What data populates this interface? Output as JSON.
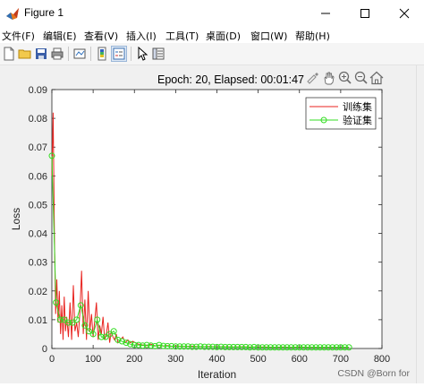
{
  "window": {
    "title": "Figure 1",
    "controls": [
      "minimize-icon",
      "maximize-icon",
      "close-icon"
    ]
  },
  "menu": {
    "items": [
      "文件(F)",
      "编辑(E)",
      "查看(V)",
      "插入(I)",
      "工具(T)",
      "桌面(D)",
      "窗口(W)",
      "帮助(H)"
    ]
  },
  "toolbar": {
    "icons": [
      "new-figure-icon",
      "open-file-icon",
      "save-icon",
      "print-icon",
      "link-plot-icon",
      "insert-colorbar-icon",
      "insert-legend-icon",
      "pointer-icon",
      "property-inspector-icon"
    ]
  },
  "axes_toolbar": {
    "icons": [
      "brush-icon",
      "pan-hand-icon",
      "zoom-in-icon",
      "zoom-out-icon",
      "home-icon"
    ]
  },
  "watermark": "CSDN @Born for",
  "chart_data": {
    "type": "line",
    "title": "Epoch: 20, Elapsed: 00:01:47",
    "xlabel": "Iteration",
    "ylabel": "Loss",
    "xlim": [
      0,
      800
    ],
    "ylim": [
      0,
      0.09
    ],
    "xticks": [
      "0",
      "100",
      "200",
      "300",
      "400",
      "500",
      "600",
      "700",
      "800"
    ],
    "yticks": [
      "0",
      "0.01",
      "0.02",
      "0.03",
      "0.04",
      "0.05",
      "0.06",
      "0.07",
      "0.08",
      "0.09"
    ],
    "legend_position": "top-right",
    "grid": false,
    "series": [
      {
        "name": "训练集",
        "color": "#e8231f",
        "marker": "none",
        "x": [
          0,
          3,
          6,
          9,
          12,
          15,
          18,
          21,
          24,
          27,
          30,
          33,
          36,
          40,
          44,
          48,
          52,
          56,
          60,
          64,
          68,
          72,
          76,
          80,
          84,
          88,
          92,
          96,
          100,
          104,
          108,
          112,
          116,
          120,
          124,
          128,
          132,
          136,
          140,
          144,
          148,
          152,
          156,
          160,
          166,
          172,
          178,
          184,
          190,
          196,
          202,
          210,
          220,
          230,
          240,
          250,
          260,
          270,
          280,
          290,
          300,
          320,
          340,
          360,
          380,
          400,
          420,
          440,
          460,
          480,
          500,
          520,
          540,
          560,
          580,
          600,
          620,
          640,
          660,
          680,
          700,
          720
        ],
        "y": [
          0.06,
          0.082,
          0.04,
          0.012,
          0.024,
          0.009,
          0.02,
          0.005,
          0.015,
          0.003,
          0.018,
          0.006,
          0.011,
          0.004,
          0.016,
          0.003,
          0.022,
          0.006,
          0.009,
          0.004,
          0.013,
          0.027,
          0.005,
          0.017,
          0.003,
          0.02,
          0.006,
          0.012,
          0.004,
          0.01,
          0.016,
          0.003,
          0.008,
          0.005,
          0.011,
          0.003,
          0.005,
          0.009,
          0.002,
          0.006,
          0.004,
          0.003,
          0.005,
          0.002,
          0.003,
          0.004,
          0.002,
          0.003,
          0.002,
          0.0025,
          0.002,
          0.0015,
          0.0012,
          0.001,
          0.0015,
          0.0009,
          0.0011,
          0.0008,
          0.001,
          0.0007,
          0.0009,
          0.0007,
          0.0008,
          0.0006,
          0.0007,
          0.0006,
          0.0006,
          0.0005,
          0.0006,
          0.0005,
          0.0005,
          0.0005,
          0.0004,
          0.0005,
          0.0004,
          0.0005,
          0.0004,
          0.0004,
          0.0004,
          0.0004,
          0.0004,
          0.0004
        ]
      },
      {
        "name": "验证集",
        "color": "#33dd22",
        "marker": "circle",
        "x": [
          0,
          10,
          20,
          30,
          40,
          50,
          60,
          70,
          80,
          90,
          100,
          110,
          120,
          130,
          140,
          150,
          160,
          170,
          180,
          190,
          200,
          210,
          220,
          230,
          240,
          250,
          260,
          270,
          280,
          290,
          300,
          310,
          320,
          330,
          340,
          350,
          360,
          370,
          380,
          390,
          400,
          410,
          420,
          430,
          440,
          450,
          460,
          470,
          480,
          490,
          500,
          510,
          520,
          530,
          540,
          550,
          560,
          570,
          580,
          590,
          600,
          610,
          620,
          630,
          640,
          650,
          660,
          670,
          680,
          690,
          700,
          710,
          720
        ],
        "y": [
          0.067,
          0.016,
          0.01,
          0.01,
          0.009,
          0.009,
          0.01,
          0.015,
          0.008,
          0.006,
          0.005,
          0.01,
          0.004,
          0.004,
          0.005,
          0.006,
          0.003,
          0.0025,
          0.002,
          0.0015,
          0.0012,
          0.0012,
          0.001,
          0.0012,
          0.001,
          0.0008,
          0.0012,
          0.0009,
          0.0008,
          0.0008,
          0.0007,
          0.0007,
          0.0007,
          0.0007,
          0.0006,
          0.0006,
          0.0007,
          0.0006,
          0.0006,
          0.0006,
          0.0005,
          0.0006,
          0.0005,
          0.0005,
          0.0005,
          0.0005,
          0.0005,
          0.0005,
          0.0004,
          0.0005,
          0.0004,
          0.0004,
          0.0004,
          0.0004,
          0.0004,
          0.0004,
          0.0004,
          0.0004,
          0.0004,
          0.0004,
          0.0004,
          0.0004,
          0.0004,
          0.0004,
          0.0004,
          0.0004,
          0.0004,
          0.0004,
          0.0004,
          0.0004,
          0.0004,
          0.0004,
          0.0004
        ]
      }
    ]
  }
}
